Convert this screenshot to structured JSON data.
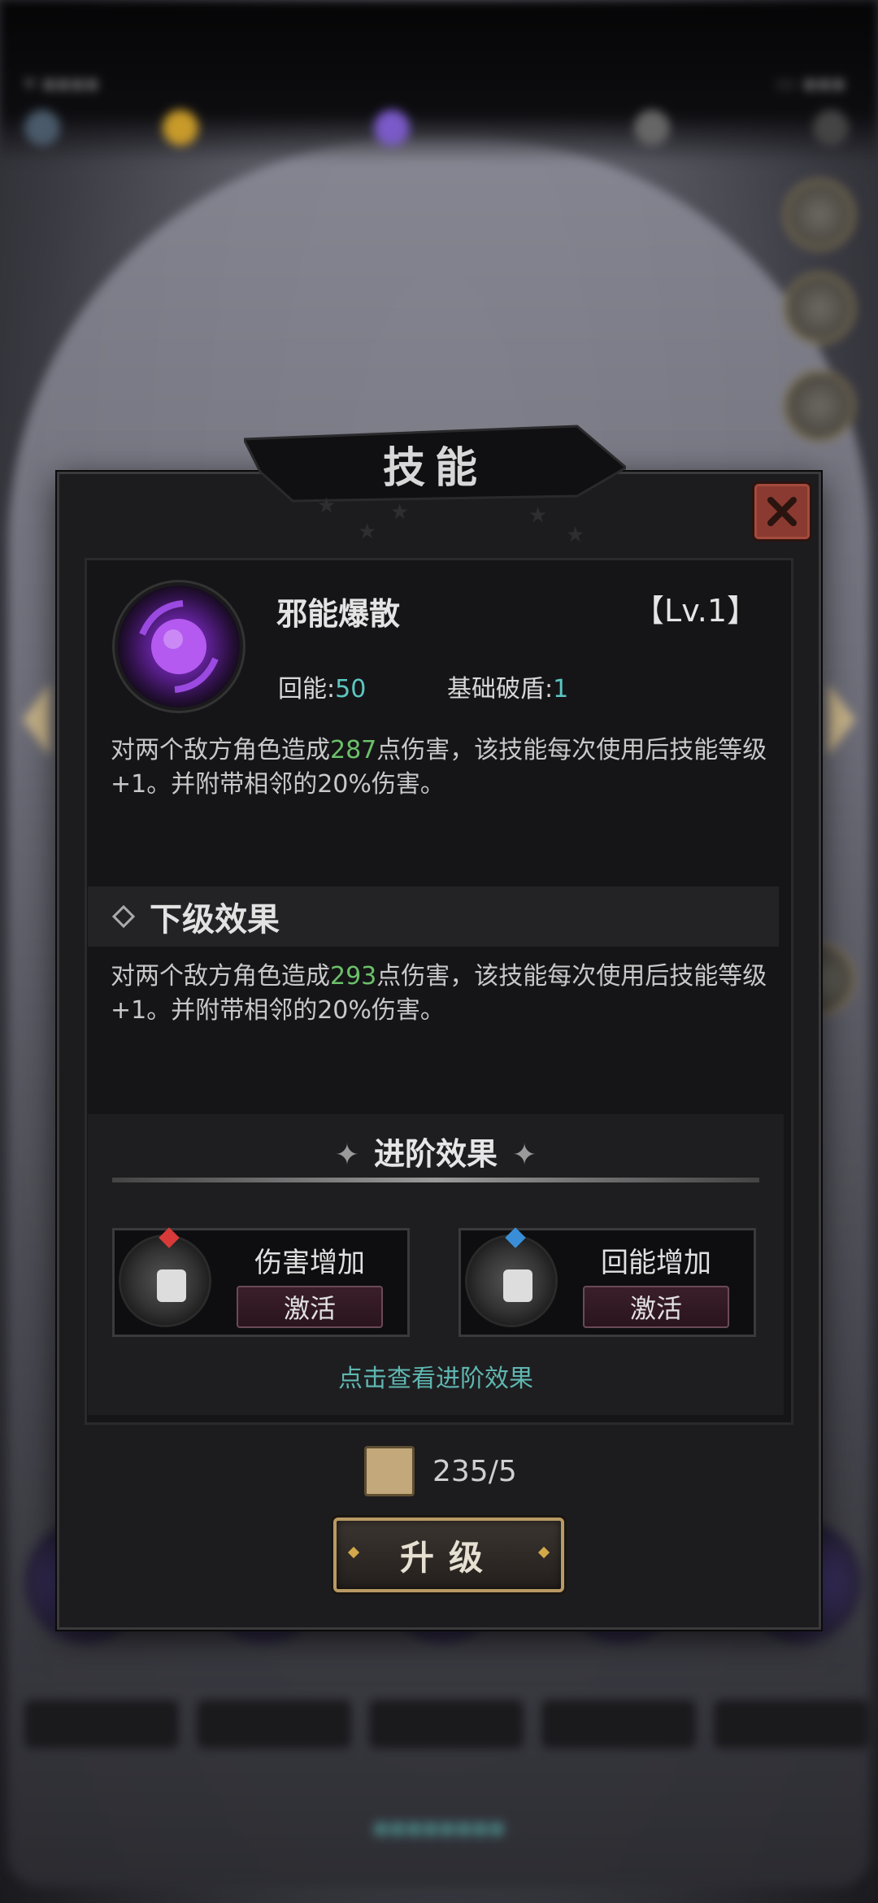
{
  "title": "技能",
  "skill": {
    "name": "邪能爆散",
    "level": "【Lv.1】",
    "energy_label": "回能:",
    "energy_value": "50",
    "shield_label": "基础破盾:",
    "shield_value": "1",
    "desc_before": "对两个敌方角色造成",
    "desc_damage": "287",
    "desc_after": "点伤害，该技能每次使用后技能等级+1。并附带相邻的20%伤害。"
  },
  "next_level": {
    "heading": "下级效果",
    "desc_before": "对两个敌方角色造成",
    "desc_damage": "293",
    "desc_after": "点伤害，该技能每次使用后技能等级+1。并附带相邻的20%伤害。"
  },
  "advanced": {
    "heading": "进阶效果",
    "cards": [
      {
        "label": "伤害增加",
        "button": "激活",
        "gem_color": "#d83a3a"
      },
      {
        "label": "回能增加",
        "button": "激活",
        "gem_color": "#3a8ed8"
      }
    ],
    "link": "点击查看进阶效果"
  },
  "cost": {
    "amount": "235/5"
  },
  "upgrade_label": "升级",
  "colors": {
    "highlight": "#6cc06a",
    "accent": "#5cc7c2",
    "gold": "#b89a64"
  }
}
